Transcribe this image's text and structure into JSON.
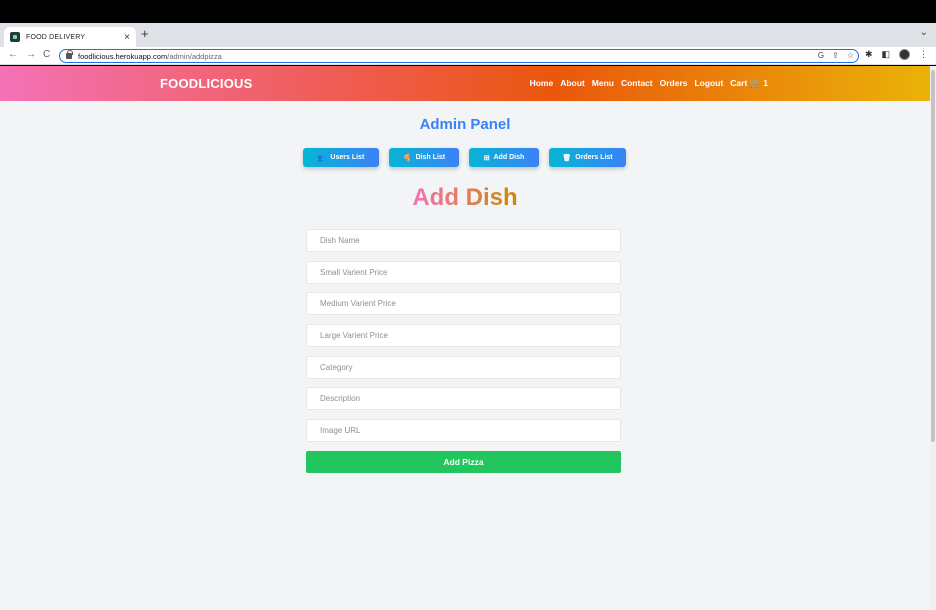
{
  "browser": {
    "tab_title": "FOOD DELIVERY",
    "tab_close": "×",
    "new_tab": "+",
    "tabs_menu": "⌄",
    "back": "←",
    "forward": "→",
    "reload": "C",
    "url_host": "foodlicious.herokuapp.com",
    "url_path": "/admin/addpizza",
    "omni_icons": [
      "G",
      "⇪",
      "☆"
    ],
    "right_icons": [
      "✱",
      "◧",
      "⋮"
    ]
  },
  "navbar": {
    "brand": "FOODLICIOUS",
    "links": [
      "Home",
      "About",
      "Menu",
      "Contact",
      "Orders",
      "Logout"
    ],
    "cart_label": "Cart",
    "cart_icon": "🛒",
    "cart_count": "1"
  },
  "admin": {
    "title": "Admin Panel",
    "buttons": [
      {
        "label": "Users List",
        "icon": "👥"
      },
      {
        "label": "Dish List",
        "icon": "🍕"
      },
      {
        "label": "Add Dish",
        "icon": "⊞"
      },
      {
        "label": "Orders List",
        "icon": "🗑"
      }
    ]
  },
  "form": {
    "title": "Add Dish",
    "fields": [
      {
        "placeholder": "Dish Name",
        "value": ""
      },
      {
        "placeholder": "Small Varient Price",
        "value": ""
      },
      {
        "placeholder": "Medium Varient Price",
        "value": ""
      },
      {
        "placeholder": "Large Varient Price",
        "value": ""
      },
      {
        "placeholder": "Category",
        "value": ""
      },
      {
        "placeholder": "Description",
        "value": ""
      },
      {
        "placeholder": "Image URL",
        "value": ""
      }
    ],
    "submit_label": "Add Pizza"
  },
  "colors": {
    "accent_blue": "#3b82f6",
    "cyan": "#06b6d4",
    "submit_green": "#22c55e",
    "page_bg": "#f3f4f6"
  }
}
